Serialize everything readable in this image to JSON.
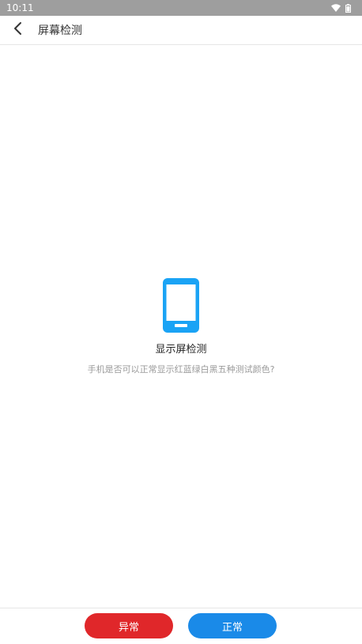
{
  "status_bar": {
    "time": "10:11",
    "icons": [
      "wifi-icon",
      "battery-icon"
    ]
  },
  "app_bar": {
    "back_icon": "back-arrow-icon",
    "title": "屏幕检测"
  },
  "content": {
    "icon": "smartphone-icon",
    "icon_color": "#1aa3f5",
    "title": "显示屏检测",
    "description": "手机是否可以正常显示红蓝绿白黑五种测试颜色?"
  },
  "actions": {
    "abnormal_label": "异常",
    "abnormal_color": "#e0272a",
    "normal_label": "正常",
    "normal_color": "#1a8ae8"
  }
}
